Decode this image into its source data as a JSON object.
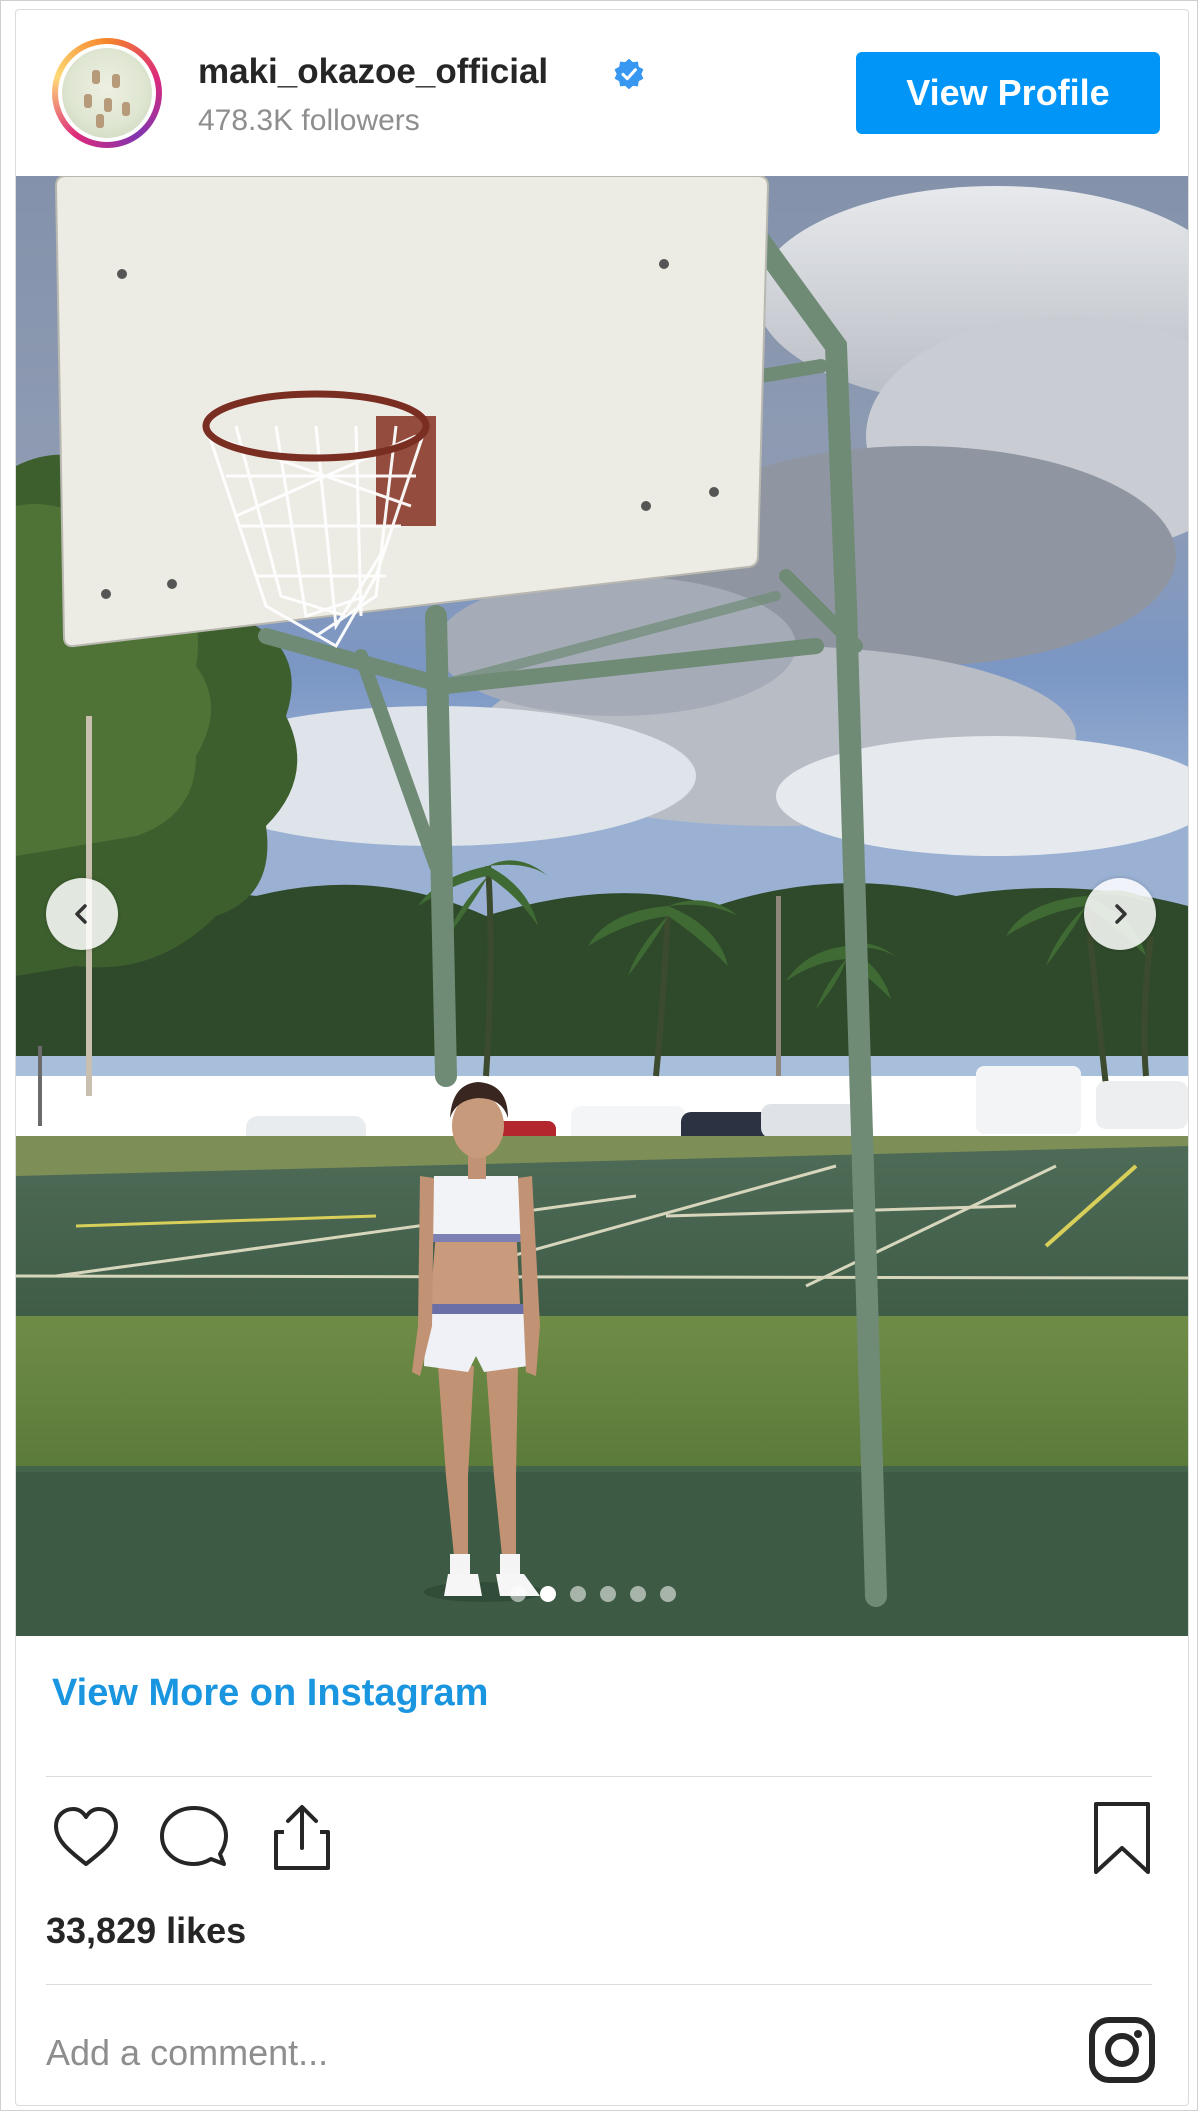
{
  "profile": {
    "username": "maki_okazoe_official",
    "followers": "478.3K followers",
    "view_profile_label": "View Profile",
    "verified": true
  },
  "carousel": {
    "slide_count": 6,
    "active_index": 1
  },
  "post": {
    "view_more_label": "View More on Instagram",
    "likes": "33,829 likes",
    "comment_placeholder": "Add a comment..."
  },
  "colors": {
    "accent": "#0095f6",
    "link": "#1a96e0",
    "text": "#262626",
    "muted": "#8e8e8e"
  },
  "icons": {
    "like": "heart-icon",
    "comment": "comment-icon",
    "share": "share-icon",
    "save": "bookmark-icon",
    "brand": "instagram-icon",
    "badge": "verified-badge-icon"
  }
}
